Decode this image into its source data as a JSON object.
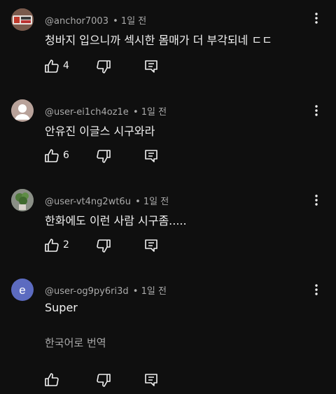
{
  "comments": [
    {
      "handle": "@anchor7003",
      "time": "• 1일 전",
      "text": "청바지 입으니까 섹시한 몸매가 더 부각되네 ㄷㄷ",
      "likes": "4",
      "avatar": "photo"
    },
    {
      "handle": "@user-ei1ch4oz1e",
      "time": "• 1일 전",
      "text": "안유진 이글스 시구와라",
      "likes": "6",
      "avatar": "default-person"
    },
    {
      "handle": "@user-vt4ng2wt6u",
      "time": "• 1일 전",
      "text": "한화에도 이런 사람 시구좀.....",
      "likes": "2",
      "avatar": "plant-photo"
    },
    {
      "handle": "@user-og9py6ri3d",
      "time": "• 1일 전",
      "text": "Super",
      "translate": "한국어로 번역",
      "likes": "",
      "avatar": "letter",
      "avatar_letter": "e",
      "avatar_color": "#5c6bc0"
    }
  ],
  "colors": {
    "background": "#0f0f0f",
    "text": "#f1f1f1",
    "secondary": "#aaaaaa"
  }
}
